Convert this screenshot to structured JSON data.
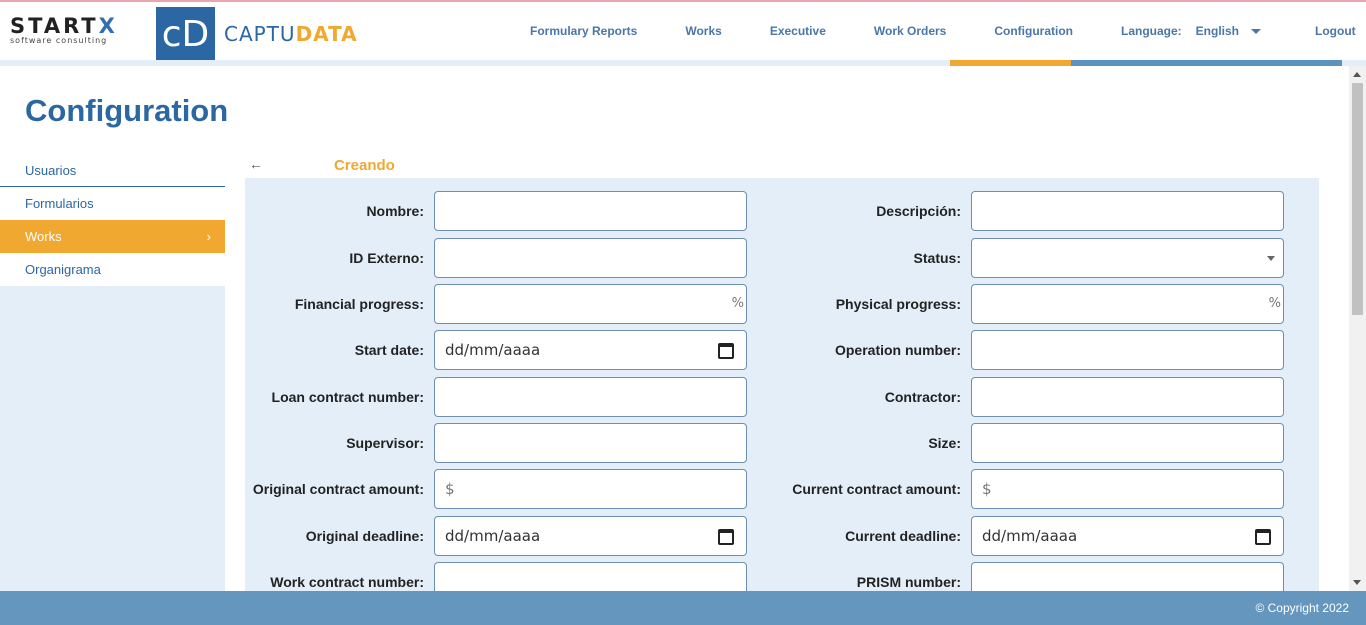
{
  "brand": {
    "startx": "START",
    "startx_x": "X",
    "startx_tagline": "software consulting",
    "cd_logo": "cD",
    "name_part1": "CAPTU",
    "name_part2": "DATA"
  },
  "nav": {
    "items": [
      "Formulary Reports",
      "Works",
      "Executive",
      "Work Orders",
      "Configuration"
    ],
    "language_label": "Language:",
    "language_value": "English",
    "logout": "Logout",
    "active": "Configuration"
  },
  "page": {
    "title": "Configuration"
  },
  "sidebar": {
    "items": [
      {
        "label": "Usuarios"
      },
      {
        "label": "Formularios"
      },
      {
        "label": "Works",
        "active": true
      },
      {
        "label": "Organigrama"
      }
    ],
    "chevron": "›"
  },
  "form": {
    "back_icon": "←",
    "title": "Creando",
    "fields": {
      "nombre": {
        "label": "Nombre:",
        "value": ""
      },
      "descripcion": {
        "label": "Descripción:",
        "value": ""
      },
      "id_externo": {
        "label": "ID Externo:",
        "value": ""
      },
      "status": {
        "label": "Status:",
        "value": ""
      },
      "financial_progress": {
        "label": "Financial progress:",
        "value": "",
        "suffix": "%"
      },
      "physical_progress": {
        "label": "Physical progress:",
        "value": "",
        "suffix": "%"
      },
      "start_date": {
        "label": "Start date:",
        "value": "dd/mm/aaaa"
      },
      "operation_number": {
        "label": "Operation number:",
        "value": ""
      },
      "loan_contract_number": {
        "label": "Loan contract number:",
        "value": ""
      },
      "contractor": {
        "label": "Contractor:",
        "value": ""
      },
      "supervisor": {
        "label": "Supervisor:",
        "value": ""
      },
      "size": {
        "label": "Size:",
        "value": ""
      },
      "original_contract_amount": {
        "label": "Original contract amount:",
        "prefix": "$"
      },
      "current_contract_amount": {
        "label": "Current contract amount:",
        "prefix": "$"
      },
      "original_deadline": {
        "label": "Original deadline:",
        "value": "dd/mm/aaaa"
      },
      "current_deadline": {
        "label": "Current deadline:",
        "value": "dd/mm/aaaa"
      },
      "work_contract_number": {
        "label": "Work contract number:",
        "value": ""
      },
      "prism_number": {
        "label": "PRISM number:",
        "value": ""
      }
    }
  },
  "footer": {
    "copyright": "© Copyright 2022"
  },
  "colors": {
    "primary": "#2b67a3",
    "accent": "#f0a830",
    "panel": "#e3eef8",
    "footer": "#6496be"
  }
}
